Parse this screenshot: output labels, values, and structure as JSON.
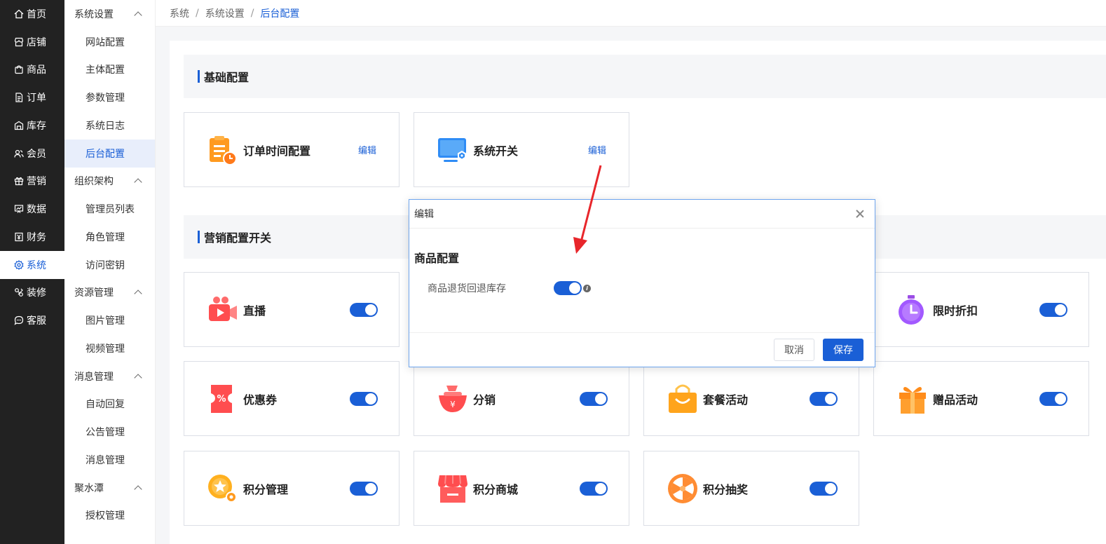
{
  "nav": {
    "items": [
      {
        "label": "首页",
        "icon": "home-icon"
      },
      {
        "label": "店铺",
        "icon": "store-icon"
      },
      {
        "label": "商品",
        "icon": "bag-icon"
      },
      {
        "label": "订单",
        "icon": "document-icon"
      },
      {
        "label": "库存",
        "icon": "warehouse-icon"
      },
      {
        "label": "会员",
        "icon": "users-icon"
      },
      {
        "label": "营销",
        "icon": "gift-icon"
      },
      {
        "label": "数据",
        "icon": "chart-icon"
      },
      {
        "label": "财务",
        "icon": "finance-icon"
      },
      {
        "label": "系统",
        "icon": "gear-icon"
      },
      {
        "label": "装修",
        "icon": "brush-icon"
      },
      {
        "label": "客服",
        "icon": "chat-icon"
      }
    ],
    "active": "系统"
  },
  "submenu": {
    "groups": [
      {
        "label": "系统设置",
        "items": [
          "网站配置",
          "主体配置",
          "参数管理",
          "系统日志",
          "后台配置"
        ]
      },
      {
        "label": "组织架构",
        "items": [
          "管理员列表",
          "角色管理",
          "访问密钥"
        ]
      },
      {
        "label": "资源管理",
        "items": [
          "图片管理",
          "视频管理"
        ]
      },
      {
        "label": "消息管理",
        "items": [
          "自动回复",
          "公告管理",
          "消息管理"
        ]
      },
      {
        "label": "聚水潭",
        "items": [
          "授权管理"
        ]
      }
    ],
    "active": "后台配置"
  },
  "breadcrumb": [
    "系统",
    "系统设置",
    "后台配置"
  ],
  "sections": {
    "basic": {
      "title": "基础配置",
      "cards": [
        {
          "title": "订单时间配置",
          "action": "编辑",
          "icon": "clipboard-clock-icon"
        },
        {
          "title": "系统开关",
          "action": "编辑",
          "icon": "monitor-settings-icon"
        }
      ]
    },
    "marketing": {
      "title": "营销配置开关",
      "cards": [
        {
          "title": "直播",
          "icon": "live-camera-icon",
          "enabled": true
        },
        {
          "title": "限时折扣",
          "icon": "stopwatch-icon",
          "enabled": true
        },
        {
          "title": "优惠券",
          "icon": "coupon-icon",
          "enabled": true
        },
        {
          "title": "分销",
          "icon": "money-bag-icon",
          "enabled": true
        },
        {
          "title": "套餐活动",
          "icon": "shopping-bag-icon",
          "enabled": true
        },
        {
          "title": "赠品活动",
          "icon": "gift-box-icon",
          "enabled": true
        },
        {
          "title": "积分管理",
          "icon": "points-star-icon",
          "enabled": true
        },
        {
          "title": "积分商城",
          "icon": "storefront-icon",
          "enabled": true
        },
        {
          "title": "积分抽奖",
          "icon": "lottery-wheel-icon",
          "enabled": true
        }
      ]
    }
  },
  "modal": {
    "title": "编辑",
    "subtitle": "商品配置",
    "row_label": "商品退货回退库存",
    "row_enabled": true,
    "cancel": "取消",
    "ok": "保存"
  },
  "colors": {
    "primary": "#1a5fd6",
    "nav_bg": "#222222"
  }
}
